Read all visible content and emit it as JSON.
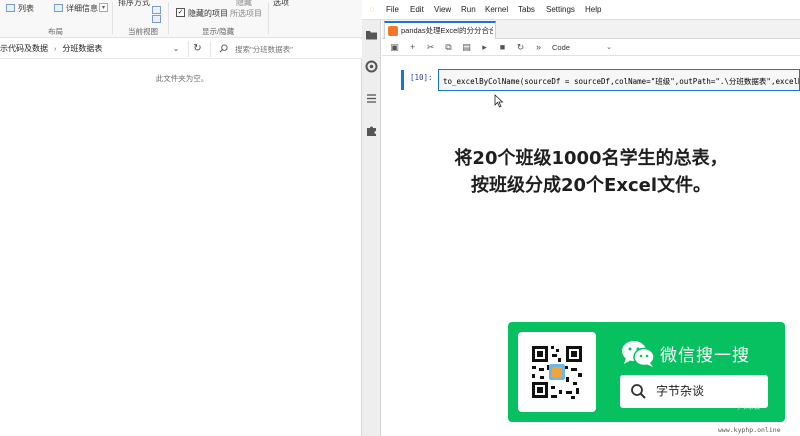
{
  "explorer": {
    "ribbon": {
      "list_label": "列表",
      "details_label": "详细信息",
      "layout_group": "布局",
      "sort_label": "排序方式",
      "current_view_group": "当前视图",
      "hidden_items_label": "隐藏的项目",
      "hide_selected_label": "所选项目",
      "show_hide_group": "显示/隐藏",
      "options_label": "选项",
      "hide_label": "隐藏"
    },
    "breadcrumb": [
      "示代码及数据",
      "分班数据表"
    ],
    "search_placeholder": "搜索\"分班数据表\"",
    "empty_message": "此文件夹为空。"
  },
  "jupyter": {
    "menu": [
      "File",
      "Edit",
      "View",
      "Run",
      "Kernel",
      "Tabs",
      "Settings",
      "Help"
    ],
    "tab_title": "pandas处理Excel的分分合合.",
    "cell_type": "Code",
    "cell_prompt": "[10]:",
    "code": "to_excelByColName(sourceDf = sourceDf,colName=\"班级\",outPath=\".\\分班数据表\",excelN"
  },
  "caption": {
    "line1": "将20个班级1000名学生的总表，",
    "line2": "按班级分成20个Excel文件。"
  },
  "wechat": {
    "title": "微信搜一搜",
    "search_text": "字节杂谈",
    "small_label": "字节杂谈",
    "brand_color": "#07c160"
  },
  "watermark": "www.kyphp.online"
}
